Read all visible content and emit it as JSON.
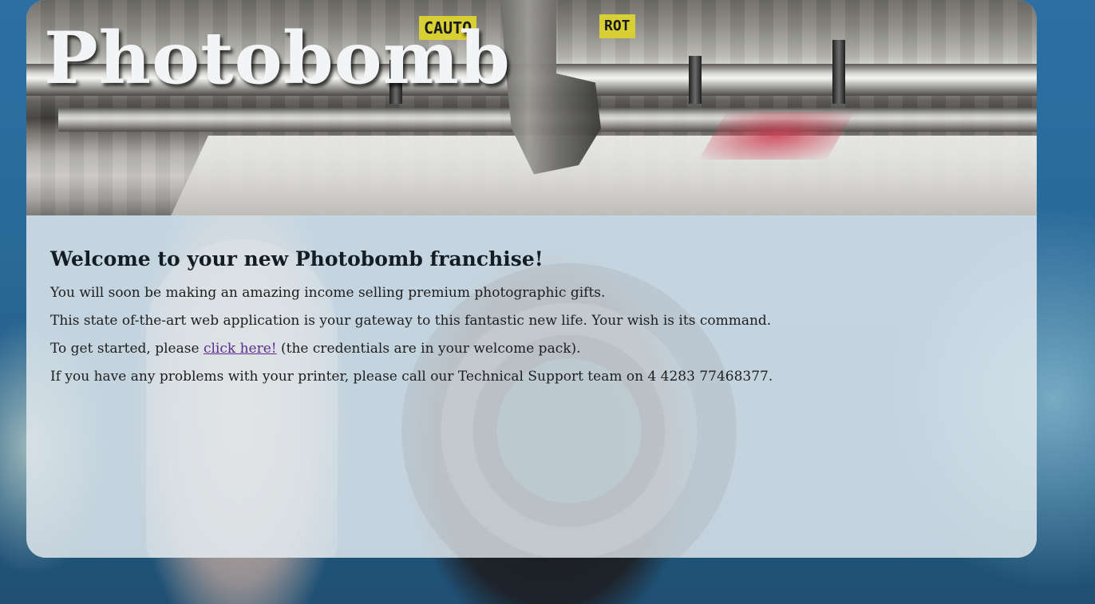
{
  "site": {
    "title": "Photobomb"
  },
  "banner": {
    "labels": [
      "CAUTO",
      "ROT"
    ]
  },
  "main": {
    "heading": "Welcome to your new Photobomb franchise!",
    "paragraphs": [
      "You will soon be making an amazing income selling premium photographic gifts.",
      "This state of-the-art web application is your gateway to this fantastic new life. Your wish is its command."
    ],
    "getting_started": {
      "prefix": "To get started, please ",
      "link_text": "click here!",
      "suffix": " (the credentials are in your welcome pack)."
    },
    "support": "If you have any problems with your printer, please call our Technical Support team on 4 4283 77468377."
  },
  "colors": {
    "link": "#5b2c8b",
    "heading": "#141c24",
    "card_background": "#dee6ec"
  }
}
